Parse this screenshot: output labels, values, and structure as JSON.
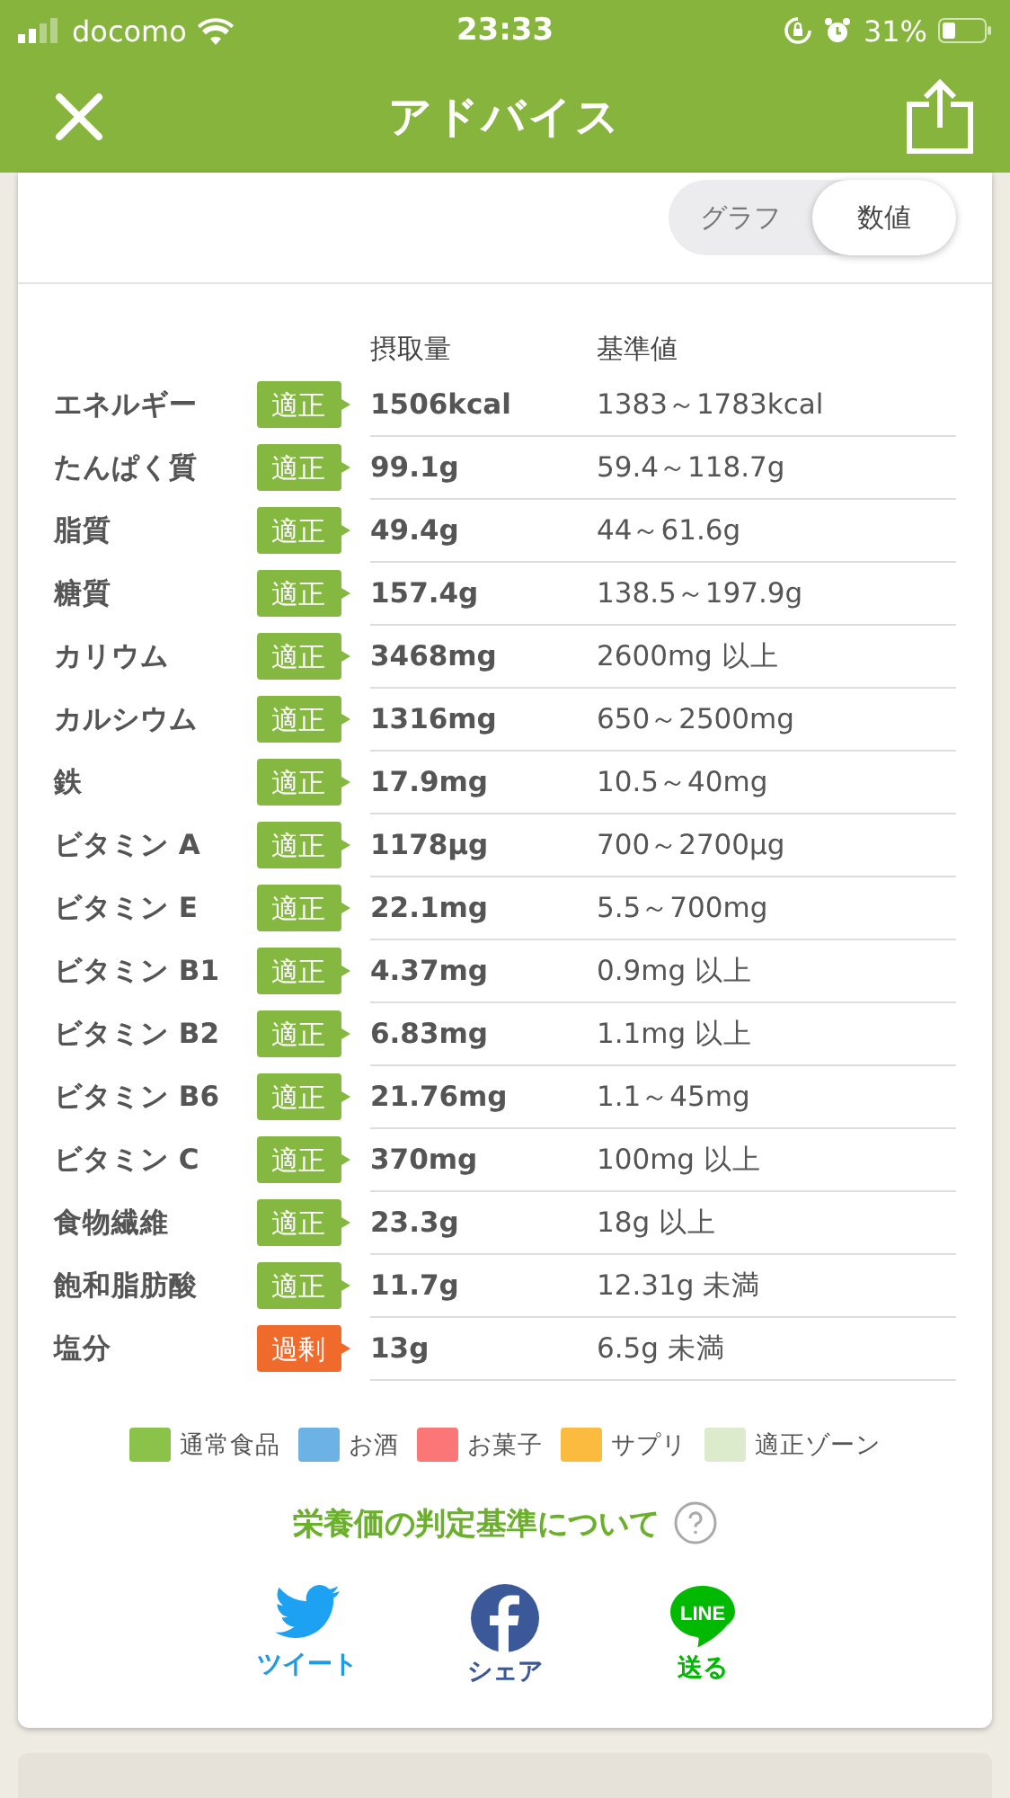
{
  "status_bar": {
    "carrier": "docomo",
    "time": "23:33",
    "battery": "31%"
  },
  "nav": {
    "title": "アドバイス"
  },
  "view_toggle": [
    {
      "label": "グラフ",
      "selected": false
    },
    {
      "label": "数値",
      "selected": true
    }
  ],
  "table": {
    "columns": [
      "摂取量",
      "基準値"
    ],
    "rows": [
      {
        "name": "エネルギー",
        "status": "適正",
        "kind": "ok",
        "intake": "1506kcal",
        "reference": "1383～1783kcal"
      },
      {
        "name": "たんぱく質",
        "status": "適正",
        "kind": "ok",
        "intake": "99.1g",
        "reference": "59.4～118.7g"
      },
      {
        "name": "脂質",
        "status": "適正",
        "kind": "ok",
        "intake": "49.4g",
        "reference": "44～61.6g"
      },
      {
        "name": "糖質",
        "status": "適正",
        "kind": "ok",
        "intake": "157.4g",
        "reference": "138.5～197.9g"
      },
      {
        "name": "カリウム",
        "status": "適正",
        "kind": "ok",
        "intake": "3468mg",
        "reference": "2600mg 以上"
      },
      {
        "name": "カルシウム",
        "status": "適正",
        "kind": "ok",
        "intake": "1316mg",
        "reference": "650～2500mg"
      },
      {
        "name": "鉄",
        "status": "適正",
        "kind": "ok",
        "intake": "17.9mg",
        "reference": "10.5～40mg"
      },
      {
        "name": "ビタミン A",
        "status": "適正",
        "kind": "ok",
        "intake": "1178µg",
        "reference": "700～2700µg"
      },
      {
        "name": "ビタミン E",
        "status": "適正",
        "kind": "ok",
        "intake": "22.1mg",
        "reference": "5.5～700mg"
      },
      {
        "name": "ビタミン B1",
        "status": "適正",
        "kind": "ok",
        "intake": "4.37mg",
        "reference": "0.9mg 以上"
      },
      {
        "name": "ビタミン B2",
        "status": "適正",
        "kind": "ok",
        "intake": "6.83mg",
        "reference": "1.1mg 以上"
      },
      {
        "name": "ビタミン B6",
        "status": "適正",
        "kind": "ok",
        "intake": "21.76mg",
        "reference": "1.1～45mg"
      },
      {
        "name": "ビタミン C",
        "status": "適正",
        "kind": "ok",
        "intake": "370mg",
        "reference": "100mg 以上"
      },
      {
        "name": "食物繊維",
        "status": "適正",
        "kind": "ok",
        "intake": "23.3g",
        "reference": "18g 以上"
      },
      {
        "name": "飽和脂肪酸",
        "status": "適正",
        "kind": "ok",
        "intake": "11.7g",
        "reference": "12.31g 未満"
      },
      {
        "name": "塩分",
        "status": "過剰",
        "kind": "over",
        "intake": "13g",
        "reference": "6.5g 未満"
      }
    ]
  },
  "legend": [
    {
      "label": "通常食品",
      "color": "#8bc34a"
    },
    {
      "label": "お酒",
      "color": "#6cb2e4"
    },
    {
      "label": "お菓子",
      "color": "#fb7677"
    },
    {
      "label": "サプリ",
      "color": "#fbbb3f"
    },
    {
      "label": "適正ゾーン",
      "color": "#dcebcb"
    }
  ],
  "criteria_link": "栄養価の判定基準について",
  "share": [
    {
      "kind": "twitter",
      "label": "ツイート"
    },
    {
      "kind": "facebook",
      "label": "シェア"
    },
    {
      "kind": "line",
      "label": "送る",
      "icon_text": "LINE"
    }
  ]
}
